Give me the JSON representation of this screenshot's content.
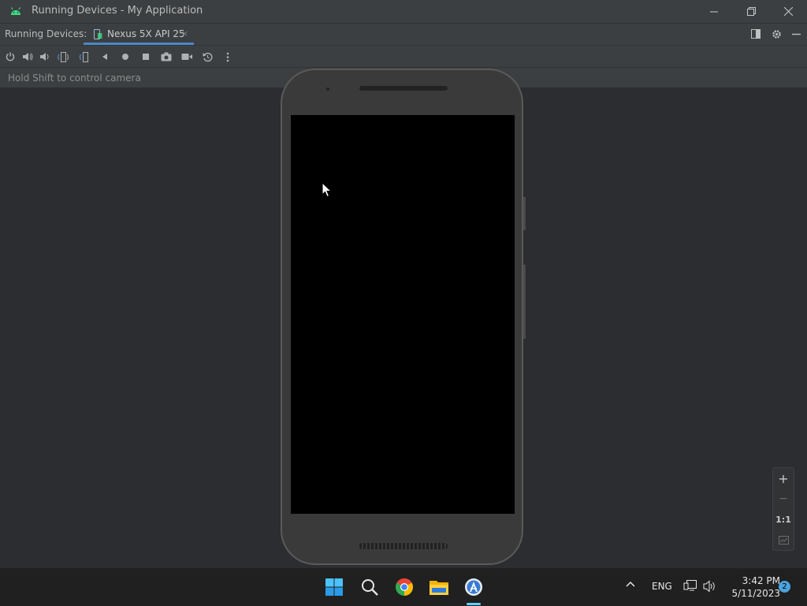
{
  "window": {
    "title": "Running Devices - My Application"
  },
  "tabbar": {
    "label": "Running Devices:",
    "active_tab": "Nexus 5X API 25",
    "close_glyph": "×"
  },
  "toolbar": {
    "buttons": [
      "power-icon",
      "volume-up-icon",
      "volume-down-icon",
      "rotate-left-icon",
      "rotate-right-icon",
      "back-icon",
      "home-icon",
      "overview-icon",
      "screenshot-icon",
      "screen-record-icon",
      "reset-icon",
      "more-icon"
    ]
  },
  "hint": {
    "text": "Hold Shift to control camera"
  },
  "zoom": {
    "in": "+",
    "out": "−",
    "actual": "1:1",
    "fit": "fit-icon"
  },
  "taskbar": {
    "lang": "ENG",
    "time": "3:42 PM",
    "date": "5/11/2023",
    "notifications": "2",
    "colors": {
      "accent": "#4a88c7",
      "badge": "#4aa3df"
    }
  }
}
